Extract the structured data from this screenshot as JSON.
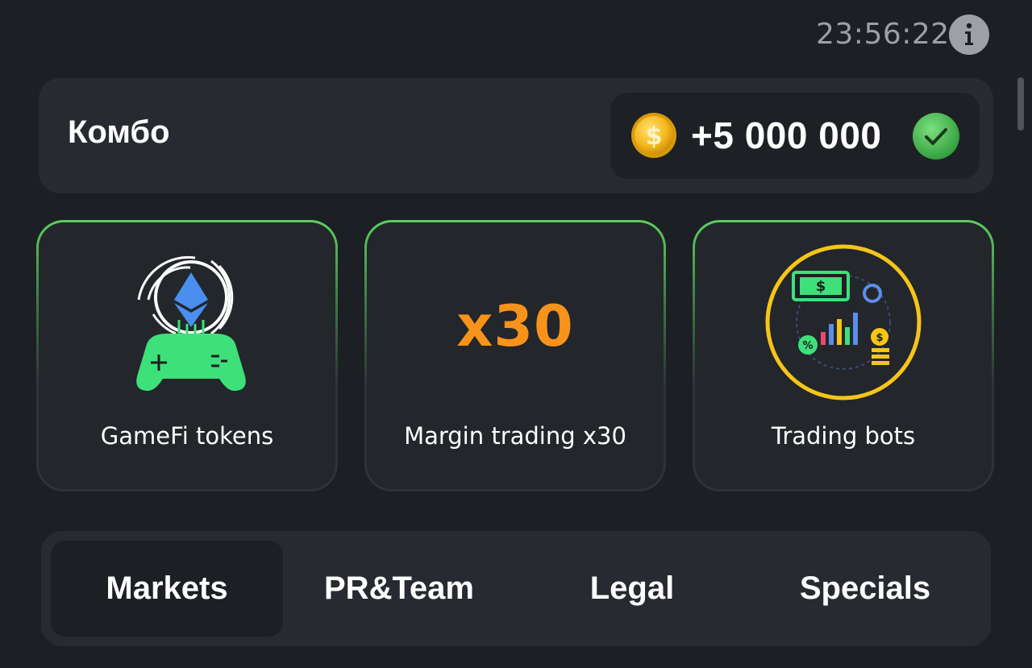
{
  "header": {
    "clock": "23:56:22",
    "info_icon": "info-icon"
  },
  "combo": {
    "title": "Комбо",
    "reward": "+5 000 000",
    "coin_icon": "coin-icon",
    "status_icon": "check-icon",
    "status_color": "#4caf50"
  },
  "cards": [
    {
      "label": "GameFi tokens",
      "icon": "gamepad-ethereum-icon"
    },
    {
      "label": "Margin trading x30",
      "art_text": "x30",
      "art_color": "#f7931a"
    },
    {
      "label": "Trading bots",
      "icon": "trading-bots-icon"
    }
  ],
  "tabs": [
    {
      "label": "Markets",
      "active": true
    },
    {
      "label": "PR&Team",
      "active": false
    },
    {
      "label": "Legal",
      "active": false
    },
    {
      "label": "Specials",
      "active": false
    }
  ],
  "colors": {
    "background": "#1c1f24",
    "panel": "#272a30",
    "accent_green": "#5ccf5e",
    "accent_orange": "#f7931a"
  }
}
